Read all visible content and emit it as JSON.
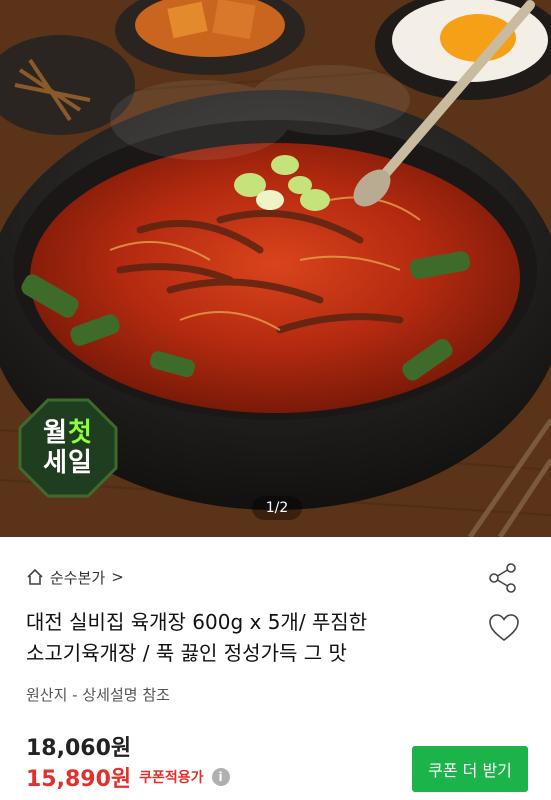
{
  "hero": {
    "image_description_icon": "yukgaejang-soup-photo",
    "badge": {
      "line1_a": "월",
      "line1_b": "첫",
      "line2": "세일"
    },
    "pager": "1/2"
  },
  "shop": {
    "name": "순수본가",
    "chevron": ">",
    "icon": "home-icon"
  },
  "product": {
    "title_line1": "대전 실비집 육개장 600g x  5개/ 푸짐한",
    "title_line2": "소고기육개장 / 푹 끓인 정성가득 그 맛",
    "origin": "원산지 - 상세설명 참조"
  },
  "price": {
    "original": "18,060원",
    "sale": "15,890원",
    "sale_label": "쿠폰적용가",
    "info_icon": "i"
  },
  "coupon_button": {
    "label": "쿠폰 더 받기"
  },
  "colors": {
    "accent_red": "#e0322b",
    "button_green": "#1cb34a",
    "badge_green": "#8cff3c"
  }
}
